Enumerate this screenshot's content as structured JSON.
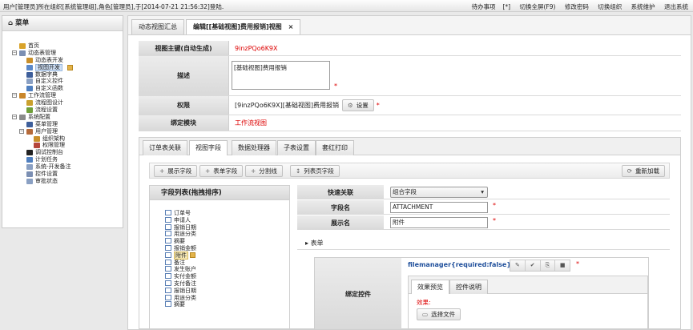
{
  "topbar": {
    "login_text": "用户[管理员]所在组织[系统管理组],角色[管理员],于[2014-07-21 21:56:32]登陆.",
    "todo_label": "待办事项",
    "todo_count": "[*]",
    "fullscreen": "切换全屏(F9)",
    "change_password": "修改密码",
    "switch_org": "切换组织",
    "maintenance": "系统维护",
    "logout": "退出系统"
  },
  "menu": {
    "title": "菜单",
    "items": [
      {
        "label": "首页",
        "level": 1,
        "expander": "",
        "icon_color": "#d9a32a"
      },
      {
        "label": "动态表管理",
        "level": 1,
        "expander": "−",
        "icon_color": "#7b8fb3"
      },
      {
        "label": "动态表开发",
        "level": 2,
        "expander": "",
        "icon_color": "#c98f2a"
      },
      {
        "label": "视图开发",
        "level": 2,
        "expander": "",
        "icon_color": "#5a88c9",
        "selected": true
      },
      {
        "label": "数据字典",
        "level": 2,
        "expander": "",
        "icon_color": "#3e5f9b"
      },
      {
        "label": "自定义控件",
        "level": 2,
        "expander": "",
        "icon_color": "#8aa0c3"
      },
      {
        "label": "自定义函数",
        "level": 2,
        "expander": "",
        "icon_color": "#4f7fbf"
      },
      {
        "label": "工作流管理",
        "level": 1,
        "expander": "−",
        "icon_color": "#c9872d"
      },
      {
        "label": "流程图设计",
        "level": 2,
        "expander": "",
        "icon_color": "#c9a02d"
      },
      {
        "label": "流程设置",
        "level": 2,
        "expander": "",
        "icon_color": "#6f9f3a"
      },
      {
        "label": "系统配置",
        "level": 1,
        "expander": "−",
        "icon_color": "#8a8a8a"
      },
      {
        "label": "菜单管理",
        "level": 2,
        "expander": "",
        "icon_color": "#3e5f9b"
      },
      {
        "label": "用户管理",
        "level": 2,
        "expander": "−",
        "icon_color": "#b56a3a"
      },
      {
        "label": "组织架构",
        "level": 3,
        "expander": "",
        "icon_color": "#c98f2a"
      },
      {
        "label": "权限管理",
        "level": 3,
        "expander": "",
        "icon_color": "#b5453a"
      },
      {
        "label": "调试控制台",
        "level": 2,
        "expander": "",
        "icon_color": "#222222"
      },
      {
        "label": "计划任务",
        "level": 2,
        "expander": "",
        "icon_color": "#4f7fbf"
      },
      {
        "label": "系统-开发备注",
        "level": 2,
        "expander": "",
        "icon_color": "#8aa0c3"
      },
      {
        "label": "控件设置",
        "level": 2,
        "expander": "",
        "icon_color": "#7b8fb3"
      },
      {
        "label": "审批状态",
        "level": 2,
        "expander": "",
        "icon_color": "#8aa0c3"
      }
    ]
  },
  "tabs": {
    "tab1": "动态视图汇总",
    "tab2": "编辑[[基础视图]费用报销]视图",
    "close": "×"
  },
  "form": {
    "view_key_label": "视图主键(自动生成)",
    "view_key_value": "9inzPQo6K9X",
    "desc_label": "描述",
    "desc_value": "[基础视图]费用报销",
    "perm_label": "权限",
    "perm_value": "[9inzPQo6K9X][基础视图]费用报销",
    "perm_button": "设置",
    "module_label": "绑定模块",
    "module_value": "工作流视图",
    "required_mark": "*"
  },
  "subtabs": [
    "订单表关联",
    "视图字段",
    "数据处理器",
    "子表设置",
    "套红打印"
  ],
  "toolbar": {
    "show_field": "展示字段",
    "form_field": "表单字段",
    "separator": "分割线",
    "list_field": "列表页字段",
    "reload": "重新加载"
  },
  "fieldlist": {
    "title": "字段列表(拖拽排序)",
    "items": [
      "订单号",
      "申请人",
      "报销日期",
      "用途分类",
      "摘要",
      "报销金额",
      "附件",
      "备注",
      "发生账户",
      "实付金额",
      "支付备注",
      "报销日期",
      "用途分类",
      "摘要"
    ],
    "selected_index": 6
  },
  "props": {
    "relation_label": "快速关联",
    "relation_value": "组合字段",
    "field_name_label": "字段名",
    "field_name_value": "ATTACHMENT",
    "display_name_label": "展示名",
    "display_name_value": "附件",
    "section_label": "表单",
    "bind_label": "绑定控件",
    "bind_value": "filemanager{required:false}",
    "preview_tab": "效果预览",
    "desc_tab": "控件说明",
    "effect_label": "效果:",
    "choose_file": "选择文件"
  }
}
